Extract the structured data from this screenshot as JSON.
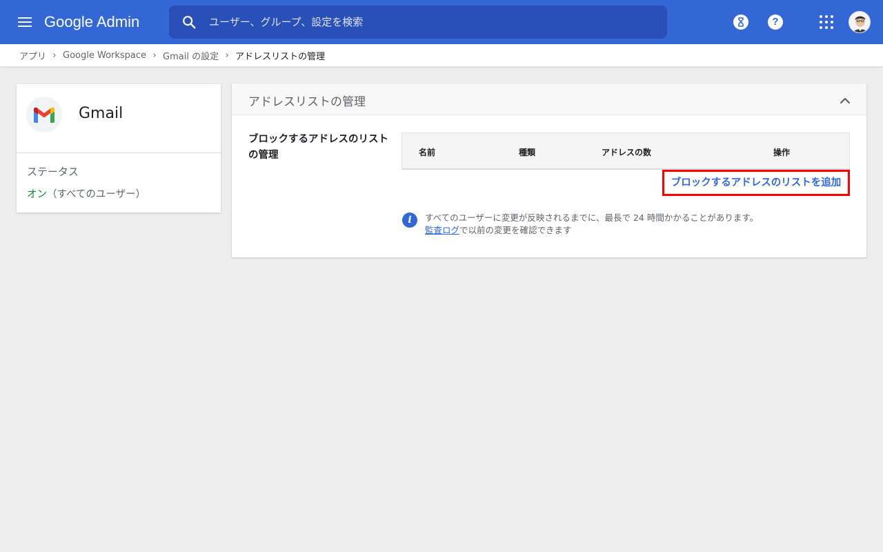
{
  "topbar": {
    "brand_google": "Google",
    "brand_admin": "Admin",
    "search_placeholder": "ユーザー、グループ、設定を検索",
    "help_glyph": "?",
    "background_color": "#3367d6"
  },
  "breadcrumb": {
    "items": [
      "アプリ",
      "Google Workspace",
      "Gmail の設定",
      "アドレスリストの管理"
    ],
    "separator": "›"
  },
  "app_card": {
    "app_name": "Gmail",
    "status_label": "ステータス",
    "status_value": "オン",
    "status_scope": "（すべてのユーザー）"
  },
  "panel": {
    "title": "アドレスリストの管理",
    "section_label": "ブロックするアドレスのリストの管理",
    "table": {
      "columns": [
        "名前",
        "種類",
        "アドレスの数",
        "操作"
      ]
    },
    "add_button_label": "ブロックするアドレスのリストを追加",
    "info": {
      "line1": "すべてのユーザーに変更が反映されるまでに、最長で 24 時間かかることがあります。",
      "audit_link": "監査ログ",
      "line2_rest": "で以前の変更を確認できます"
    }
  },
  "colors": {
    "accent": "#3367d6",
    "status_on": "#188038",
    "highlight_border": "#ff0000"
  },
  "icons": [
    "menu-icon",
    "search-icon",
    "hourglass-icon",
    "help-icon",
    "apps-grid-icon",
    "user-avatar",
    "gmail-logo",
    "chevron-up-icon",
    "info-icon"
  ]
}
